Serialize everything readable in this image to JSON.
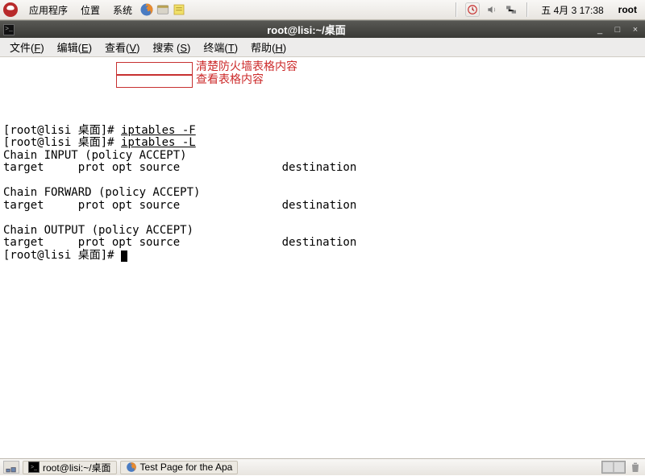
{
  "top_panel": {
    "menus": [
      "应用程序",
      "位置",
      "系统"
    ],
    "clock": "五 4月  3 17:38",
    "user": "root"
  },
  "window": {
    "title": "root@lisi:~/桌面"
  },
  "menubar": {
    "items": [
      {
        "label": "文件",
        "key": "F"
      },
      {
        "label": "编辑",
        "key": "E"
      },
      {
        "label": "查看",
        "key": "V"
      },
      {
        "label": "搜索",
        "key": "S"
      },
      {
        "label": "终端",
        "key": "T"
      },
      {
        "label": "帮助",
        "key": "H"
      }
    ]
  },
  "terminal": {
    "prompt1": "[root@lisi 桌面]# ",
    "cmd1": "iptables -F",
    "annot1": "清楚防火墙表格内容",
    "prompt2": "[root@lisi 桌面]# ",
    "cmd2": "iptables -L",
    "annot2": "查看表格内容",
    "out1": "Chain INPUT (policy ACCEPT)",
    "out2": "target     prot opt source               destination",
    "blank1": "",
    "out3": "Chain FORWARD (policy ACCEPT)",
    "out4": "target     prot opt source               destination",
    "blank2": "",
    "out5": "Chain OUTPUT (policy ACCEPT)",
    "out6": "target     prot opt source               destination",
    "prompt3": "[root@lisi 桌面]# "
  },
  "bottom_panel": {
    "task1": "root@lisi:~/桌面",
    "task2": "Test Page for the Apa"
  }
}
